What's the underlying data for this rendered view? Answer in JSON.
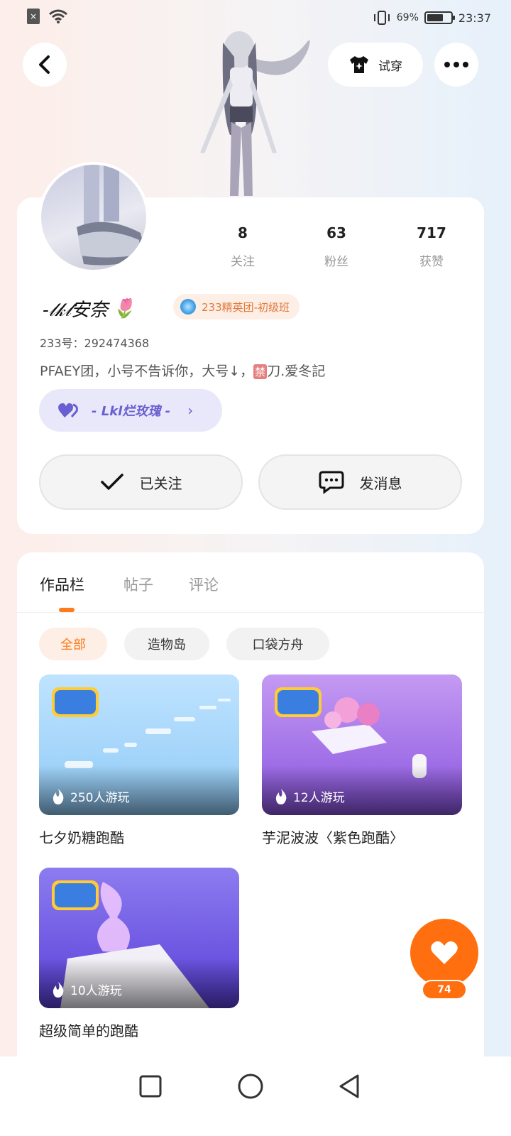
{
  "status_bar": {
    "battery_percent": "69%",
    "time": "23:37",
    "battery_level": 0.69
  },
  "top": {
    "tryon_label": "试穿"
  },
  "profile": {
    "stats": [
      {
        "value": "8",
        "label": "关注"
      },
      {
        "value": "63",
        "label": "粉丝"
      },
      {
        "value": "717",
        "label": "获赞"
      }
    ],
    "nickname": "-𝓁𝓀𝓁安奈",
    "nickname_emoji": "🌷",
    "badge": "233精英团-初级班",
    "uid": "233号：292474368",
    "bio_before": "PFAEY团，小号不告诉你，大号↓，",
    "bio_ban": "禁",
    "bio_after": "刀.爱冬記",
    "group": {
      "name": "- Lkl烂玫瑰 -",
      "chevron": "›"
    },
    "follow_label": "已关注",
    "message_label": "发消息"
  },
  "tabs": [
    {
      "label": "作品栏",
      "active": true
    },
    {
      "label": "帖子",
      "active": false
    },
    {
      "label": "评论",
      "active": false
    }
  ],
  "filters": [
    {
      "label": "全部",
      "active": true
    },
    {
      "label": "造物岛",
      "active": false
    },
    {
      "label": "口袋方舟",
      "active": false
    }
  ],
  "games": [
    {
      "title": "七夕奶糖跑酷",
      "plays": "250人游玩"
    },
    {
      "title": "芋泥波波〈紫色跑酷〉",
      "plays": "12人游玩"
    },
    {
      "title": "超级简单的跑酷",
      "plays": "10人游玩"
    }
  ],
  "like_fab": {
    "count": "74"
  },
  "colors": {
    "accent": "#ff6f0f",
    "group": "#6a5fd0"
  }
}
